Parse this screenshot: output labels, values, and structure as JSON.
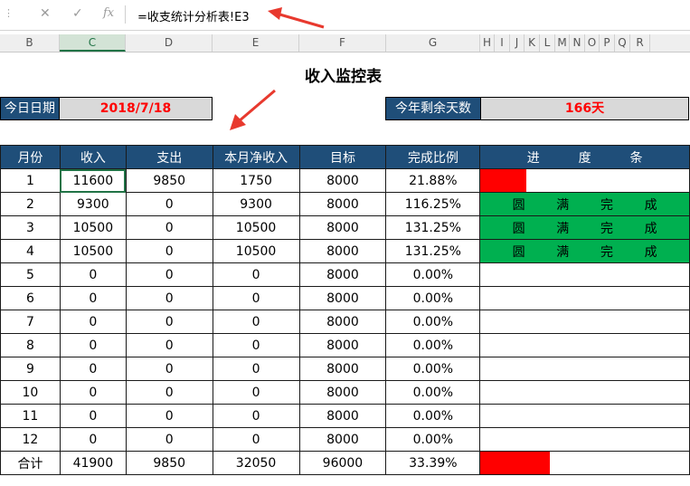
{
  "formula_bar": {
    "cancel_icon": "✕",
    "enter_icon": "✓",
    "fx_label": "fx",
    "formula": "=收支统计分析表!E3"
  },
  "columns": [
    "B",
    "C",
    "D",
    "E",
    "F",
    "G",
    "H",
    "I",
    "J",
    "K",
    "L",
    "M",
    "N",
    "O",
    "P",
    "Q",
    "R"
  ],
  "active_column": "C",
  "sheet": {
    "title": "收入监控表",
    "today_label": "今日日期",
    "today_value": "2018/7/18",
    "remaining_label": "今年剩余天数",
    "remaining_value": "166天",
    "headers": [
      "月份",
      "收入",
      "支出",
      "本月净收入",
      "目标",
      "完成比例"
    ],
    "progress_header": [
      "进",
      "度",
      "条"
    ],
    "done_chars": [
      "圆",
      "满",
      "完",
      "成"
    ],
    "rows": [
      {
        "month": "1",
        "income": "11600",
        "expense": "9850",
        "net": "1750",
        "target": "8000",
        "ratio": "21.88%",
        "progress": 0.2188
      },
      {
        "month": "2",
        "income": "9300",
        "expense": "0",
        "net": "9300",
        "target": "8000",
        "ratio": "116.25%",
        "progress": 1.1625
      },
      {
        "month": "3",
        "income": "10500",
        "expense": "0",
        "net": "10500",
        "target": "8000",
        "ratio": "131.25%",
        "progress": 1.3125
      },
      {
        "month": "4",
        "income": "10500",
        "expense": "0",
        "net": "10500",
        "target": "8000",
        "ratio": "131.25%",
        "progress": 1.3125
      },
      {
        "month": "5",
        "income": "0",
        "expense": "0",
        "net": "0",
        "target": "8000",
        "ratio": "0.00%",
        "progress": 0
      },
      {
        "month": "6",
        "income": "0",
        "expense": "0",
        "net": "0",
        "target": "8000",
        "ratio": "0.00%",
        "progress": 0
      },
      {
        "month": "7",
        "income": "0",
        "expense": "0",
        "net": "0",
        "target": "8000",
        "ratio": "0.00%",
        "progress": 0
      },
      {
        "month": "8",
        "income": "0",
        "expense": "0",
        "net": "0",
        "target": "8000",
        "ratio": "0.00%",
        "progress": 0
      },
      {
        "month": "9",
        "income": "0",
        "expense": "0",
        "net": "0",
        "target": "8000",
        "ratio": "0.00%",
        "progress": 0
      },
      {
        "month": "10",
        "income": "0",
        "expense": "0",
        "net": "0",
        "target": "8000",
        "ratio": "0.00%",
        "progress": 0
      },
      {
        "month": "11",
        "income": "0",
        "expense": "0",
        "net": "0",
        "target": "8000",
        "ratio": "0.00%",
        "progress": 0
      },
      {
        "month": "12",
        "income": "0",
        "expense": "0",
        "net": "0",
        "target": "8000",
        "ratio": "0.00%",
        "progress": 0
      }
    ],
    "total": {
      "month": "合计",
      "income": "41900",
      "expense": "9850",
      "net": "32050",
      "target": "96000",
      "ratio": "33.39%",
      "progress": 0.3339
    }
  },
  "colors": {
    "header_bg": "#1f4e79",
    "highlight": "#ff0000",
    "complete": "#00b050",
    "arrow": "#e8392e"
  }
}
